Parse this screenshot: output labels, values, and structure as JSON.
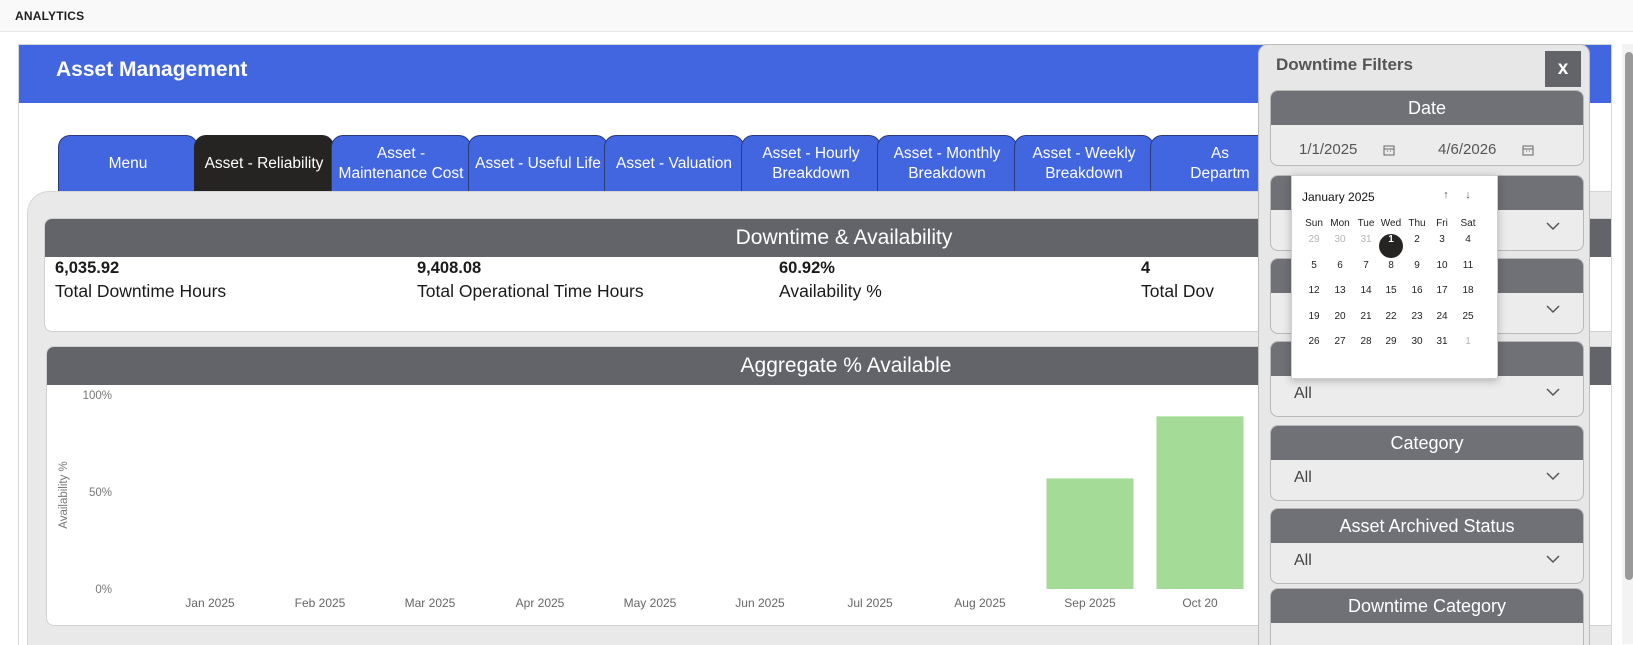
{
  "app_title": "ANALYTICS",
  "banner": {
    "title": "Asset Management"
  },
  "tabs": [
    {
      "label": "Menu",
      "active": false
    },
    {
      "label": "Asset - Reliability",
      "active": true
    },
    {
      "label": "Asset -\nMaintenance Cost",
      "active": false
    },
    {
      "label": "Asset - Useful Life",
      "active": false
    },
    {
      "label": "Asset - Valuation",
      "active": false
    },
    {
      "label": "Asset - Hourly\nBreakdown",
      "active": false
    },
    {
      "label": "Asset - Monthly\nBreakdown",
      "active": false
    },
    {
      "label": "Asset - Weekly\nBreakdown",
      "active": false
    },
    {
      "label": "As\nDepartm",
      "active": false
    }
  ],
  "kpis": {
    "section_title": "Downtime & Availability",
    "items": [
      {
        "value": "6,035.92",
        "label": "Total Downtime Hours"
      },
      {
        "value": "9,408.08",
        "label": "Total Operational Time Hours"
      },
      {
        "value": "60.92%",
        "label": "Availability %"
      },
      {
        "value": "4",
        "label": "Total Dov"
      }
    ]
  },
  "chart": {
    "section_title": "Aggregate % Available"
  },
  "chart_data": {
    "type": "bar",
    "title": "Aggregate % Available",
    "xlabel": "",
    "ylabel": "Availability %",
    "ylim": [
      0,
      100
    ],
    "yticks": [
      "100%",
      "50%",
      "0%"
    ],
    "categories": [
      "Jan 2025",
      "Feb 2025",
      "Mar 2025",
      "Apr 2025",
      "May 2025",
      "Jun 2025",
      "Jul 2025",
      "Aug 2025",
      "Sep 2025",
      "Oct 20"
    ],
    "values": [
      0,
      0,
      0,
      0,
      0,
      0,
      0,
      0,
      57,
      89
    ],
    "bar_color": "#a3db97",
    "grid": false
  },
  "filters": {
    "title": "Downtime Filters",
    "close_label": "x",
    "date": {
      "label": "Date",
      "start": "1/1/2025",
      "end": "4/6/2026"
    },
    "boxes": [
      {
        "label": "",
        "value": ""
      },
      {
        "label": "",
        "value": ""
      },
      {
        "label": "",
        "value": "All"
      },
      {
        "label": "Category",
        "value": "All"
      },
      {
        "label": "Asset Archived Status",
        "value": "All"
      },
      {
        "label": "Downtime Category",
        "value": ""
      }
    ]
  },
  "calendar": {
    "month_label": "January 2025",
    "weekdays": [
      "Sun",
      "Mon",
      "Tue",
      "Wed",
      "Thu",
      "Fri",
      "Sat"
    ],
    "weeks": [
      [
        "29",
        "30",
        "31",
        "1",
        "2",
        "3",
        "4"
      ],
      [
        "5",
        "6",
        "7",
        "8",
        "9",
        "10",
        "11"
      ],
      [
        "12",
        "13",
        "14",
        "15",
        "16",
        "17",
        "18"
      ],
      [
        "19",
        "20",
        "21",
        "22",
        "23",
        "24",
        "25"
      ],
      [
        "26",
        "27",
        "28",
        "29",
        "30",
        "31",
        "1"
      ]
    ],
    "selected": "1",
    "prev_arrow": "↑",
    "next_arrow": "↓"
  },
  "colors": {
    "accent": "#4166e0",
    "header_gray": "#636469",
    "active_tab": "#252423",
    "bar": "#a3db97"
  }
}
